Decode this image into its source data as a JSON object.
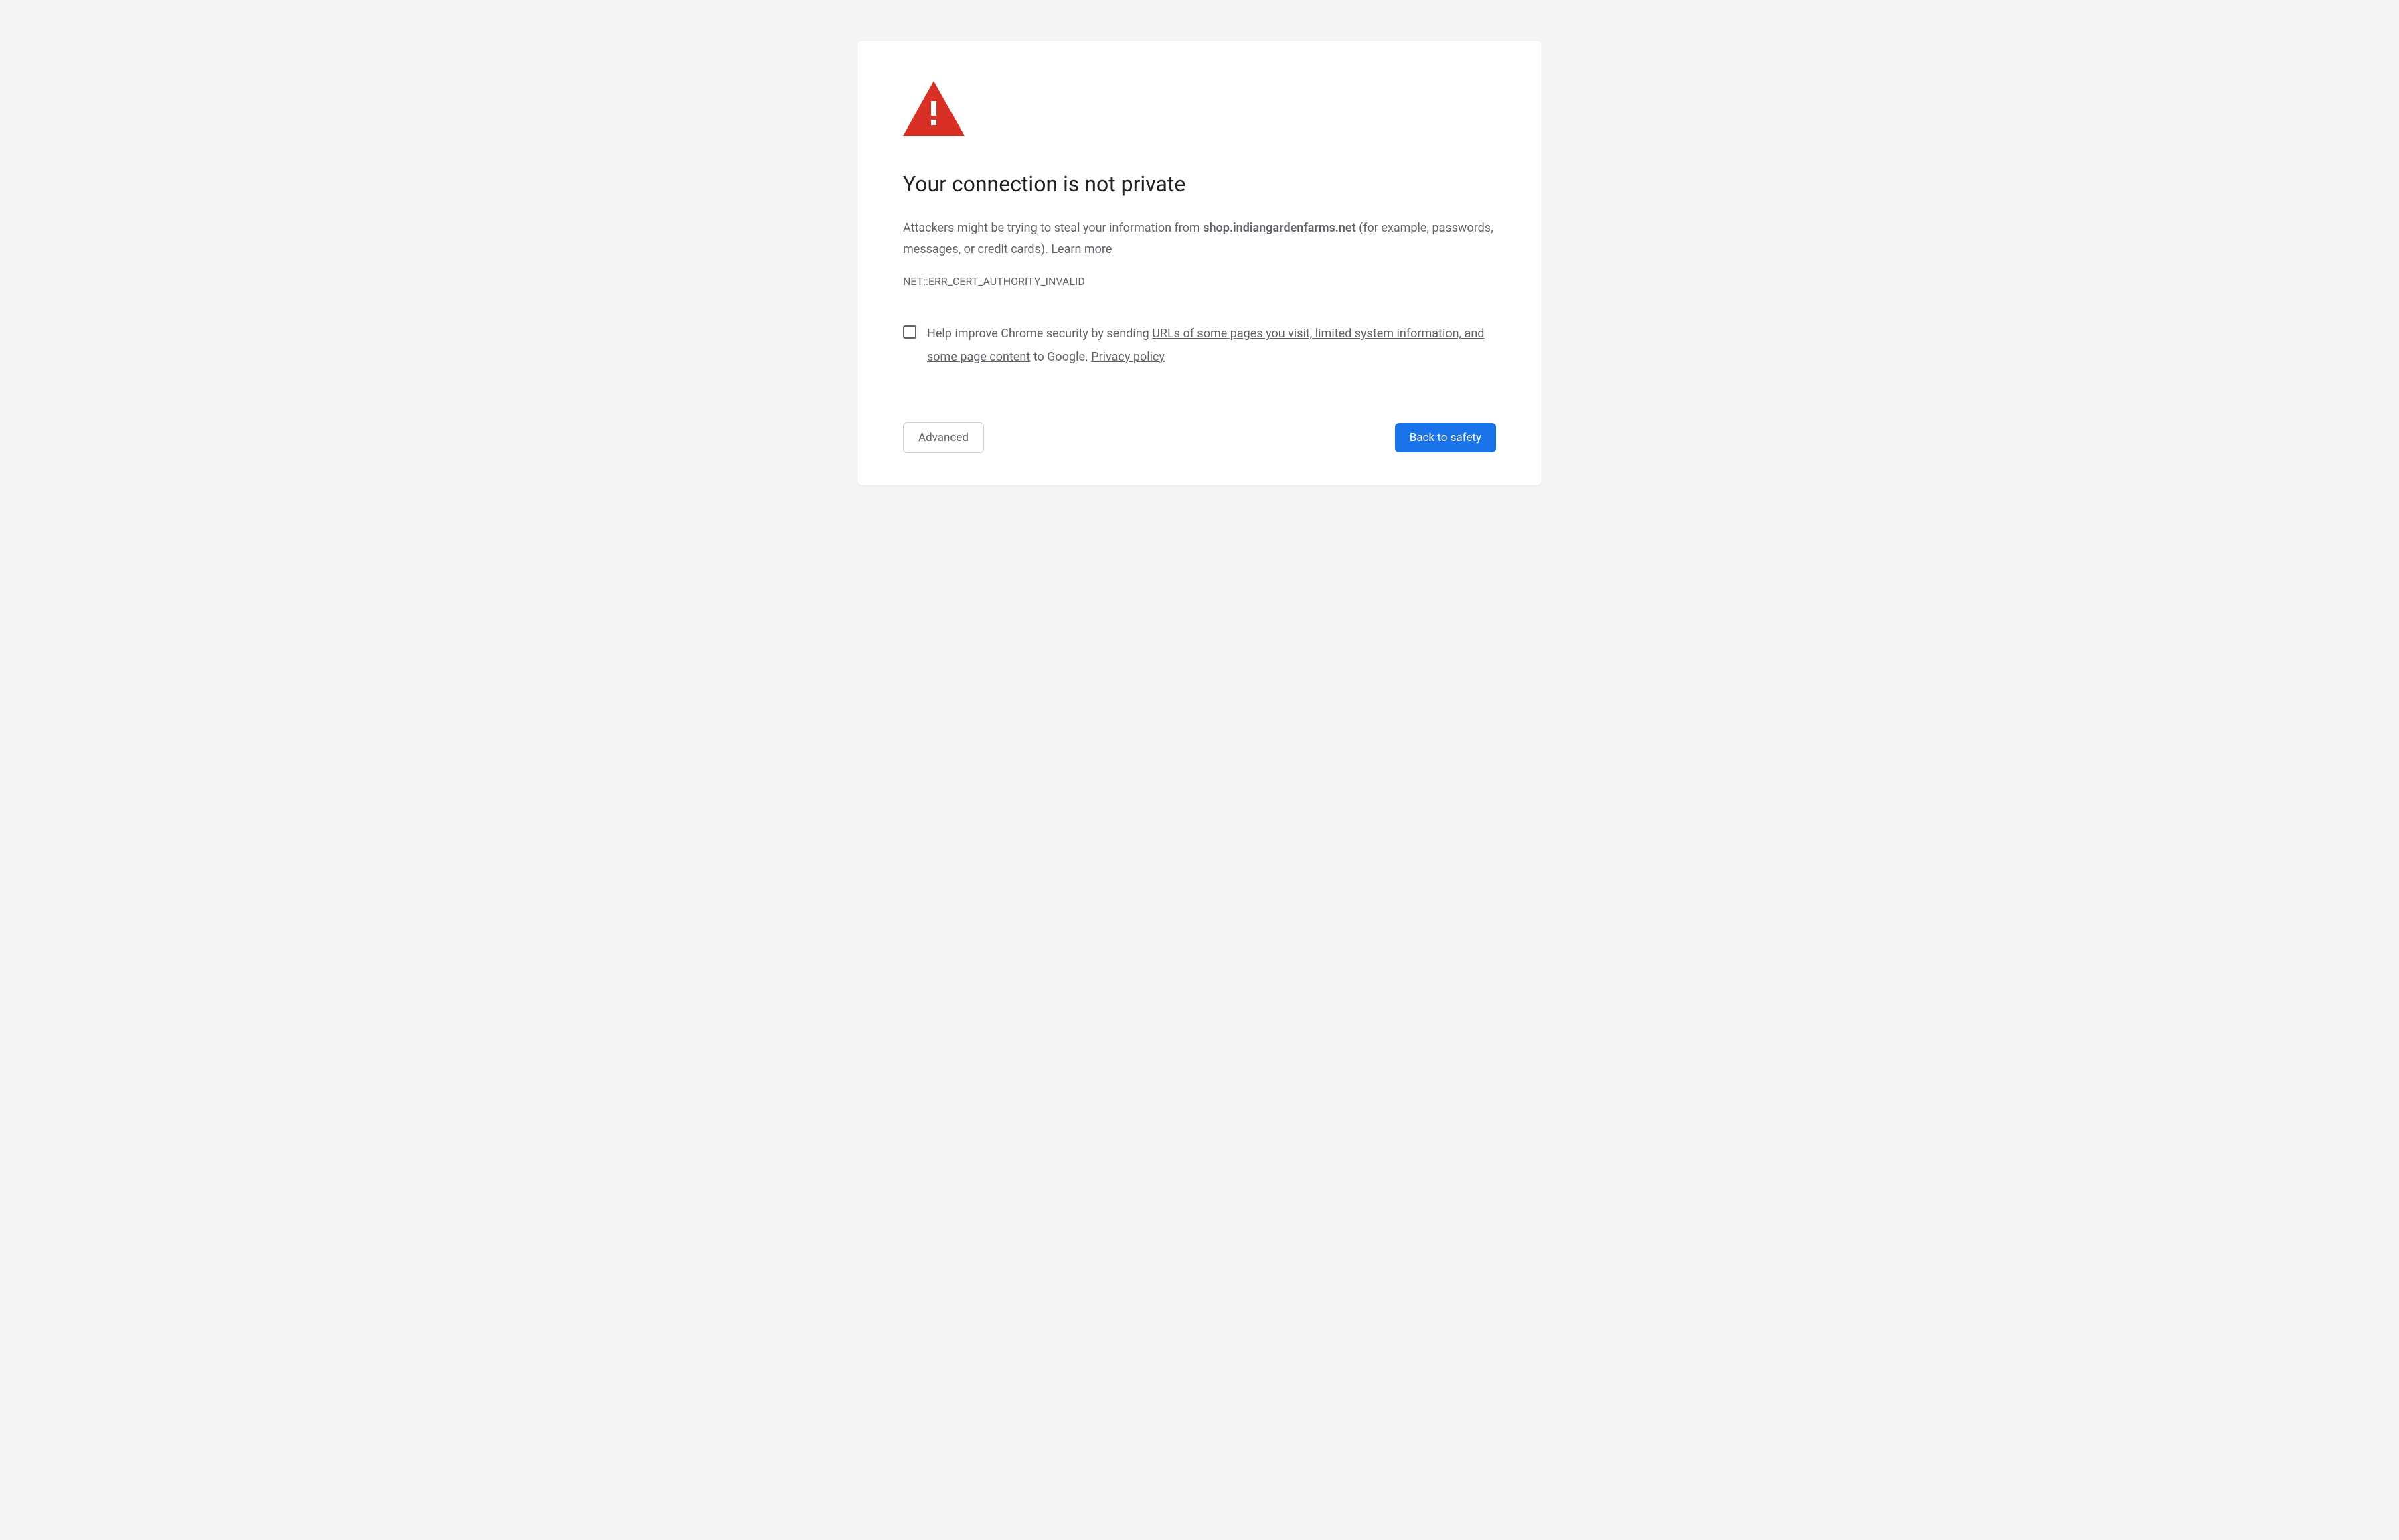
{
  "heading": "Your connection is not private",
  "description": {
    "prefix": "Attackers might be trying to steal your information from ",
    "domain": "shop.indiangardenfarms.net",
    "suffix": " (for example, passwords, messages, or credit cards). ",
    "learn_more": "Learn more"
  },
  "error_code": "NET::ERR_CERT_AUTHORITY_INVALID",
  "optin": {
    "prefix": "Help improve Chrome security by sending ",
    "link1": "URLs of some pages you visit, limited system information, and some page content",
    "middle": " to Google. ",
    "privacy_link": "Privacy policy"
  },
  "buttons": {
    "advanced": "Advanced",
    "back_to_safety": "Back to safety"
  },
  "colors": {
    "warning_red": "#d93025",
    "primary_blue": "#1a73e8",
    "text_gray": "#5f6368"
  }
}
